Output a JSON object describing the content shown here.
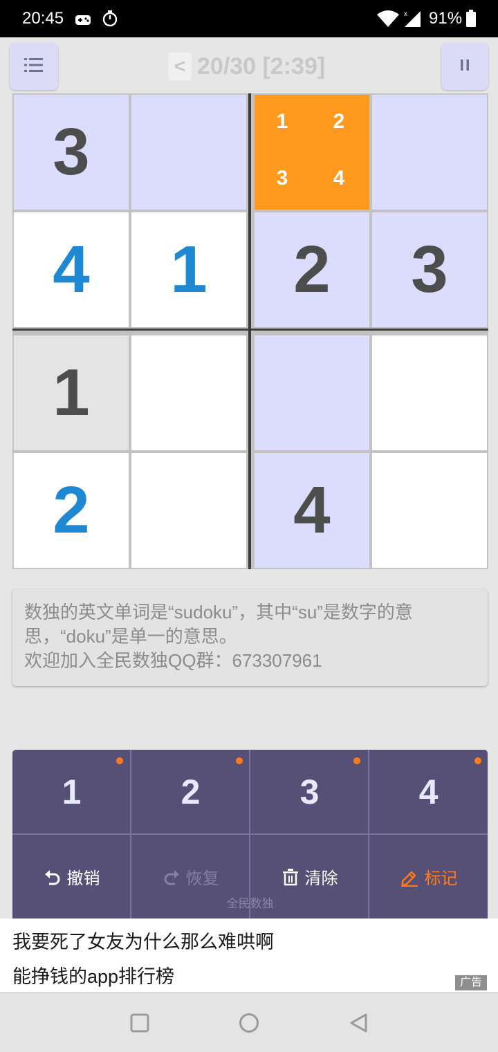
{
  "status_bar": {
    "time": "20:45",
    "battery": "91%",
    "icons": [
      "gamepad-icon",
      "timer-icon",
      "wifi-icon",
      "cell-signal-icon",
      "battery-icon"
    ]
  },
  "toolbar": {
    "back_label": "<",
    "title": "20/30 [2:39]",
    "menu_icon": "list-icon",
    "pause_icon": "pause-icon"
  },
  "board": {
    "size": 4,
    "rows": [
      [
        {
          "value": "3",
          "kind": "given",
          "bg": "lav"
        },
        {
          "value": "",
          "kind": "empty",
          "bg": "lav"
        },
        {
          "value": "",
          "kind": "selected",
          "bg": "orange",
          "notes": [
            "1",
            "2",
            "3",
            "4"
          ]
        },
        {
          "value": "",
          "kind": "empty",
          "bg": "lav"
        }
      ],
      [
        {
          "value": "4",
          "kind": "user",
          "bg": "white"
        },
        {
          "value": "1",
          "kind": "user",
          "bg": "white"
        },
        {
          "value": "2",
          "kind": "given",
          "bg": "lav"
        },
        {
          "value": "3",
          "kind": "given",
          "bg": "lav"
        }
      ],
      [
        {
          "value": "1",
          "kind": "given",
          "bg": "grey"
        },
        {
          "value": "",
          "kind": "empty",
          "bg": "white"
        },
        {
          "value": "",
          "kind": "empty",
          "bg": "lav"
        },
        {
          "value": "",
          "kind": "empty",
          "bg": "white"
        }
      ],
      [
        {
          "value": "2",
          "kind": "user",
          "bg": "white"
        },
        {
          "value": "",
          "kind": "empty",
          "bg": "white"
        },
        {
          "value": "4",
          "kind": "given",
          "bg": "lav"
        },
        {
          "value": "",
          "kind": "empty",
          "bg": "white"
        }
      ]
    ]
  },
  "tip": {
    "line1": "数独的英文单词是“sudoku”，其中“su”是数字的意",
    "line2": "思，“doku”是单一的意思。",
    "line3": "欢迎加入全民数独QQ群：673307961"
  },
  "number_pad": {
    "numbers": [
      "1",
      "2",
      "3",
      "4"
    ],
    "actions": [
      {
        "label": "撤销",
        "icon": "undo-icon",
        "enabled": true
      },
      {
        "label": "恢复",
        "icon": "redo-icon",
        "enabled": false
      },
      {
        "label": "清除",
        "icon": "trash-icon",
        "enabled": true
      },
      {
        "label": "标记",
        "icon": "pencil-icon",
        "enabled": true,
        "active": true
      }
    ],
    "watermark": "全民数独"
  },
  "ad": {
    "line1": "我要死了女友为什么那么难哄啊",
    "line2": "能挣钱的app排行榜",
    "tag": "广告"
  },
  "nav_bar": {
    "icons": [
      "recents-square-icon",
      "home-circle-icon",
      "back-triangle-icon"
    ]
  },
  "colors": {
    "selected_cell": "#ff9a1e",
    "highlight_cell": "#dcdcfc",
    "user_digit": "#1e88d2",
    "given_digit": "#4d4d4d",
    "pad_background": "#565076",
    "note_dot": "#ff7a1a",
    "mark_active": "#ff7a1a"
  }
}
